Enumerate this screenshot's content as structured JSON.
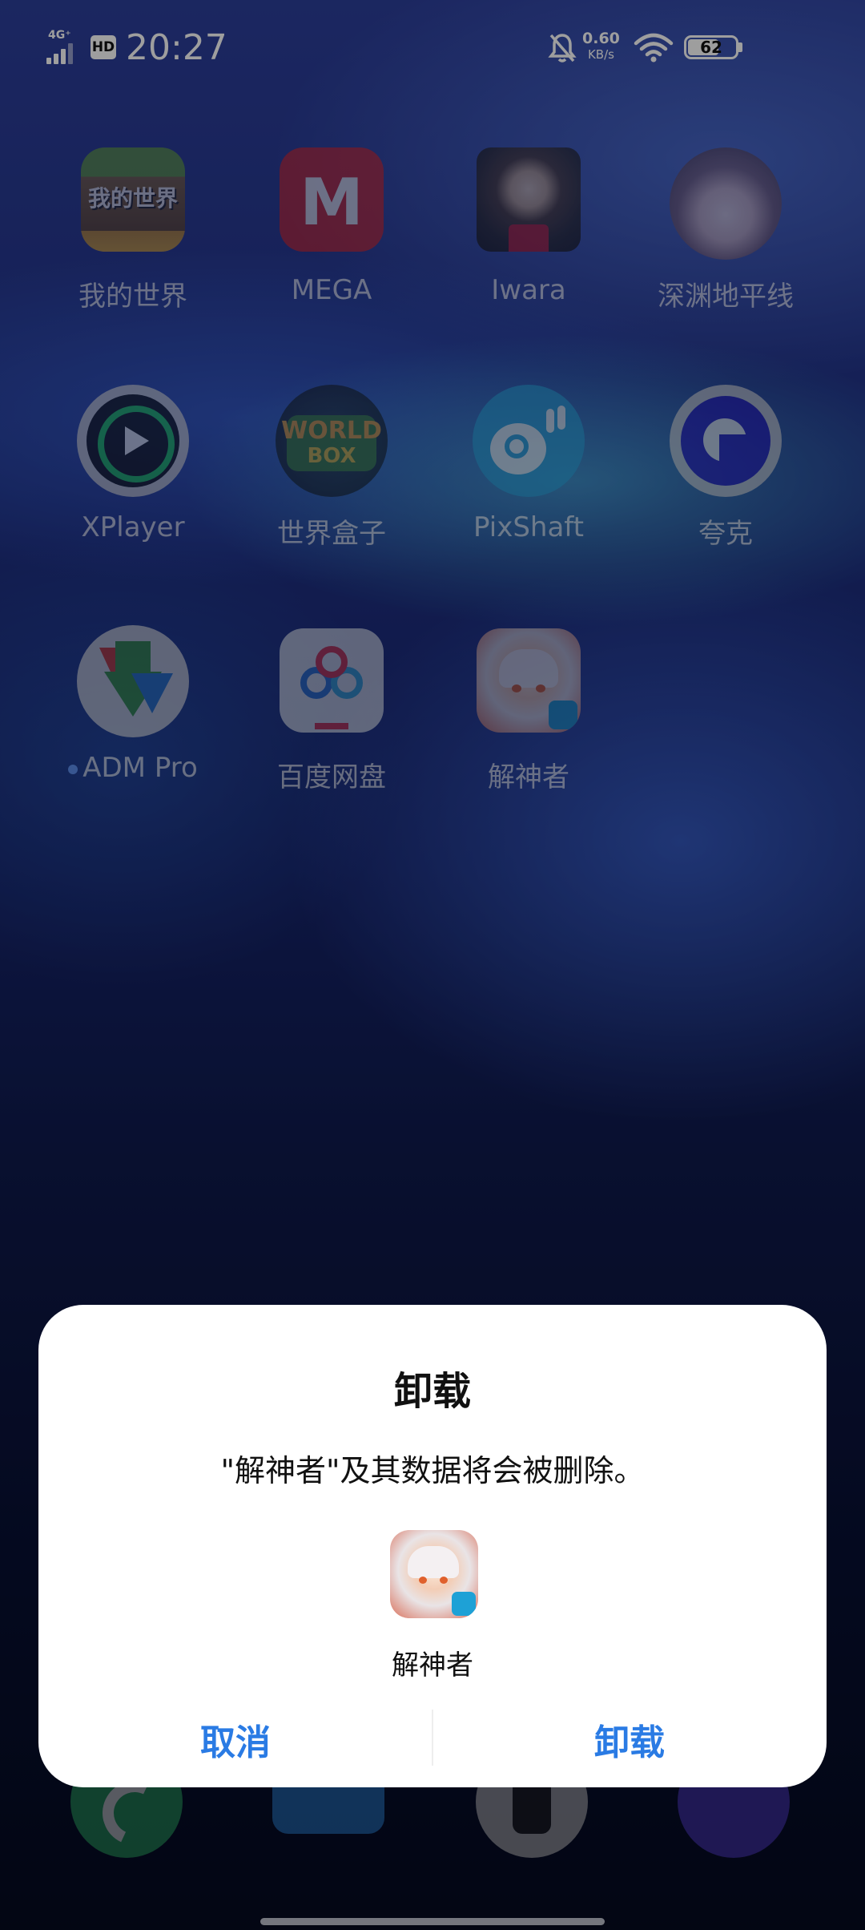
{
  "status_bar": {
    "network": "4G⁺",
    "hd": "HD",
    "time": "20:27",
    "speed_value": "0.60",
    "speed_unit": "KB/s",
    "battery": "62"
  },
  "apps": [
    {
      "label": "我的世界",
      "icon": "minecraft-icon"
    },
    {
      "label": "MEGA",
      "icon": "mega-icon"
    },
    {
      "label": "Iwara",
      "icon": "iwara-icon"
    },
    {
      "label": "深渊地平线",
      "icon": "abyss-horizon-icon"
    },
    {
      "label": "XPlayer",
      "icon": "xplayer-icon"
    },
    {
      "label": "世界盒子",
      "icon": "worldbox-icon"
    },
    {
      "label": "PixShaft",
      "icon": "pixshaft-icon"
    },
    {
      "label": "夸克",
      "icon": "quark-icon"
    },
    {
      "label": "ADM Pro",
      "icon": "adm-pro-icon"
    },
    {
      "label": "百度网盘",
      "icon": "baidu-netdisk-icon"
    },
    {
      "label": "解神者",
      "icon": "x-epic-icon"
    }
  ],
  "icon_text": {
    "mega": "M",
    "worldbox_top": "WORLD",
    "worldbox_bottom": "BOX",
    "minecraft": "我的世界"
  },
  "dock": [
    "phone-icon",
    "messages-icon",
    "camera-icon",
    "browser-icon"
  ],
  "dialog": {
    "title": "卸载",
    "message": "\"解神者\"及其数据将会被删除。",
    "app_name": "解神者",
    "cancel": "取消",
    "confirm": "卸载"
  },
  "colors": {
    "accent": "#2a7be4",
    "mega_red": "#d9272e",
    "dialog_bg": "#ffffff"
  }
}
